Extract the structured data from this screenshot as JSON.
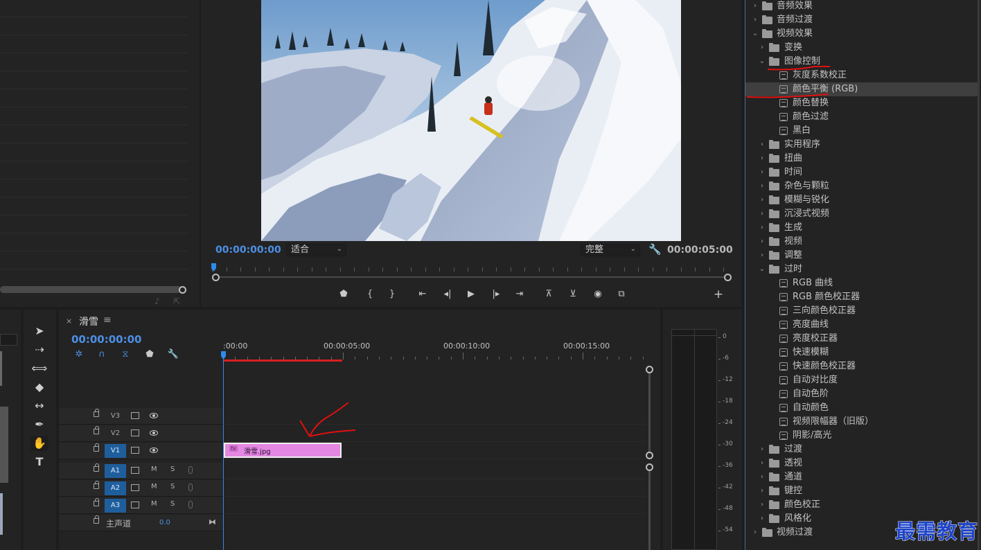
{
  "program_monitor": {
    "current_timecode": "00:00:00:00",
    "zoom_select": "适合",
    "quality_select": "完整",
    "duration_timecode": "00:00:05:00"
  },
  "timeline": {
    "sequence_name": "滑雪",
    "close_glyph": "×",
    "menu_glyph": "≡",
    "timecode": "00:00:00:00",
    "ruler_labels": [
      ":00:00",
      "00:00:05:00",
      "00:00:10:00",
      "00:00:15:00"
    ],
    "video_tracks": [
      {
        "name": "V3",
        "targeted": false
      },
      {
        "name": "V2",
        "targeted": false
      },
      {
        "name": "V1",
        "targeted": true
      }
    ],
    "audio_tracks": [
      {
        "name": "A1",
        "m": "M",
        "s": "S"
      },
      {
        "name": "A2",
        "m": "M",
        "s": "S"
      },
      {
        "name": "A3",
        "m": "M",
        "s": "S"
      }
    ],
    "master": {
      "label": "主声道",
      "value": "0.0"
    },
    "clip": {
      "fx": "fx",
      "name": "滑雪.jpg"
    }
  },
  "audio_meter": {
    "db_labels": [
      "0",
      "-6",
      "-12",
      "-18",
      "-24",
      "-30",
      "-36",
      "-42",
      "-48",
      "-54"
    ]
  },
  "effects": {
    "items": [
      {
        "depth": 0,
        "type": "folder",
        "expanded": false,
        "label": "音频效果"
      },
      {
        "depth": 0,
        "type": "folder",
        "expanded": false,
        "label": "音频过渡"
      },
      {
        "depth": 0,
        "type": "folder",
        "expanded": true,
        "label": "视频效果"
      },
      {
        "depth": 1,
        "type": "folder",
        "expanded": false,
        "label": "变换"
      },
      {
        "depth": 1,
        "type": "folder",
        "expanded": true,
        "label": "图像控制"
      },
      {
        "depth": 2,
        "type": "effect",
        "label": "灰度系数校正"
      },
      {
        "depth": 2,
        "type": "effect",
        "label": "颜色平衡 (RGB)",
        "selected": true
      },
      {
        "depth": 2,
        "type": "effect",
        "label": "颜色替换"
      },
      {
        "depth": 2,
        "type": "effect",
        "label": "颜色过滤"
      },
      {
        "depth": 2,
        "type": "effect",
        "label": "黑白"
      },
      {
        "depth": 1,
        "type": "folder",
        "expanded": false,
        "label": "实用程序"
      },
      {
        "depth": 1,
        "type": "folder",
        "expanded": false,
        "label": "扭曲"
      },
      {
        "depth": 1,
        "type": "folder",
        "expanded": false,
        "label": "时间"
      },
      {
        "depth": 1,
        "type": "folder",
        "expanded": false,
        "label": "杂色与颗粒"
      },
      {
        "depth": 1,
        "type": "folder",
        "expanded": false,
        "label": "模糊与锐化"
      },
      {
        "depth": 1,
        "type": "folder",
        "expanded": false,
        "label": "沉浸式视频"
      },
      {
        "depth": 1,
        "type": "folder",
        "expanded": false,
        "label": "生成"
      },
      {
        "depth": 1,
        "type": "folder",
        "expanded": false,
        "label": "视频"
      },
      {
        "depth": 1,
        "type": "folder",
        "expanded": false,
        "label": "调整"
      },
      {
        "depth": 1,
        "type": "folder",
        "expanded": true,
        "label": "过时"
      },
      {
        "depth": 2,
        "type": "effect",
        "label": "RGB 曲线"
      },
      {
        "depth": 2,
        "type": "effect",
        "label": "RGB 颜色校正器"
      },
      {
        "depth": 2,
        "type": "effect",
        "label": "三向颜色校正器"
      },
      {
        "depth": 2,
        "type": "effect",
        "label": "亮度曲线"
      },
      {
        "depth": 2,
        "type": "effect",
        "label": "亮度校正器"
      },
      {
        "depth": 2,
        "type": "effect",
        "label": "快速模糊"
      },
      {
        "depth": 2,
        "type": "effect",
        "label": "快速颜色校正器"
      },
      {
        "depth": 2,
        "type": "effect",
        "label": "自动对比度"
      },
      {
        "depth": 2,
        "type": "effect",
        "label": "自动色阶"
      },
      {
        "depth": 2,
        "type": "effect",
        "label": "自动颜色"
      },
      {
        "depth": 2,
        "type": "effect",
        "label": "视频限幅器（旧版）"
      },
      {
        "depth": 2,
        "type": "effect",
        "label": "阴影/高光"
      },
      {
        "depth": 1,
        "type": "folder",
        "expanded": false,
        "label": "过渡"
      },
      {
        "depth": 1,
        "type": "folder",
        "expanded": false,
        "label": "透视"
      },
      {
        "depth": 1,
        "type": "folder",
        "expanded": false,
        "label": "通道"
      },
      {
        "depth": 1,
        "type": "folder",
        "expanded": false,
        "label": "键控"
      },
      {
        "depth": 1,
        "type": "folder",
        "expanded": false,
        "label": "颜色校正"
      },
      {
        "depth": 1,
        "type": "folder",
        "expanded": false,
        "label": "风格化"
      },
      {
        "depth": 0,
        "type": "folder",
        "expanded": false,
        "label": "视频过渡"
      }
    ]
  },
  "watermark": "最需教育",
  "colors": {
    "accent_blue": "#4d8fe4",
    "clip_pink": "#e487e2",
    "work_area_red": "#d62020",
    "annotation_red": "#e01010"
  }
}
